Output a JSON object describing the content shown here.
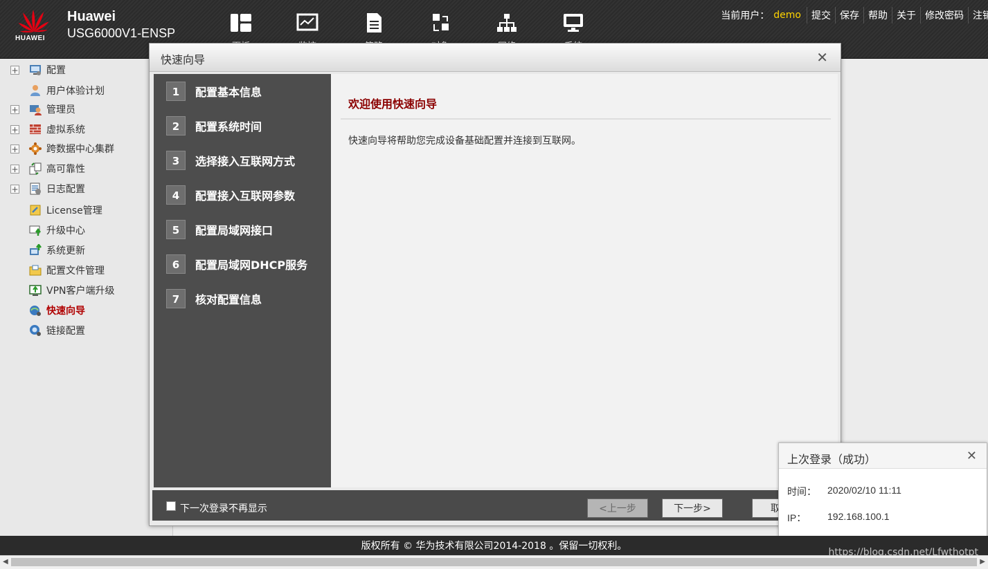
{
  "header": {
    "logo_text": "HUAWEI",
    "brand_name": "Huawei",
    "device_model": "USG6000V1-ENSP",
    "nav": [
      {
        "label": "面板",
        "icon": "dashboard-icon"
      },
      {
        "label": "监控",
        "icon": "monitor-icon"
      },
      {
        "label": "策略",
        "icon": "policy-icon"
      },
      {
        "label": "对象",
        "icon": "object-icon"
      },
      {
        "label": "网络",
        "icon": "network-icon"
      },
      {
        "label": "系统",
        "icon": "system-icon"
      }
    ],
    "current_user_label": "当前用户：",
    "current_user": "demo",
    "links": [
      "提交",
      "保存",
      "帮助",
      "关于",
      "修改密码",
      "注销"
    ]
  },
  "sidebar": {
    "items": [
      {
        "label": "配置",
        "expandable": true
      },
      {
        "label": "用户体验计划",
        "expandable": false
      },
      {
        "label": "管理员",
        "expandable": true
      },
      {
        "label": "虚拟系统",
        "expandable": true
      },
      {
        "label": "跨数据中心集群",
        "expandable": true
      },
      {
        "label": "高可靠性",
        "expandable": true
      },
      {
        "label": "日志配置",
        "expandable": true
      },
      {
        "label": "License管理",
        "expandable": false
      },
      {
        "label": "升级中心",
        "expandable": false
      },
      {
        "label": "系统更新",
        "expandable": false
      },
      {
        "label": "配置文件管理",
        "expandable": false
      },
      {
        "label": "VPN客户端升级",
        "expandable": false
      },
      {
        "label": "快速向导",
        "expandable": false,
        "active": true
      },
      {
        "label": "链接配置",
        "expandable": false
      }
    ]
  },
  "dialog": {
    "title": "快速向导",
    "steps": [
      {
        "num": "1",
        "label": "配置基本信息"
      },
      {
        "num": "2",
        "label": "配置系统时间"
      },
      {
        "num": "3",
        "label": "选择接入互联网方式"
      },
      {
        "num": "4",
        "label": "配置接入互联网参数"
      },
      {
        "num": "5",
        "label": "配置局域网接口"
      },
      {
        "num": "6",
        "label": "配置局域网DHCP服务"
      },
      {
        "num": "7",
        "label": "核对配置信息"
      }
    ],
    "content_title": "欢迎使用快速向导",
    "content_text": "快速向导将帮助您完成设备基础配置并连接到互联网。",
    "dont_show_label": "下一次登录不再显示",
    "prev_button": "<上一步",
    "next_button": "下一步>",
    "cancel_button": "取消"
  },
  "login_popup": {
    "title": "上次登录（成功）",
    "time_label": "时间：",
    "time_value": "2020/02/10 11:11",
    "ip_label": "IP：",
    "ip_value": "192.168.100.1"
  },
  "footer": {
    "copyright": "版权所有 © 华为技术有限公司2014-2018 。保留一切权利。",
    "watermark": "https://blog.csdn.net/Lfwthotpt"
  },
  "colors": {
    "header_bg": "#2b2b2b",
    "user_highlight": "#ffd400",
    "active_item": "#b00000",
    "step_panel": "#4d4d4d",
    "content_title": "#8b0000"
  }
}
